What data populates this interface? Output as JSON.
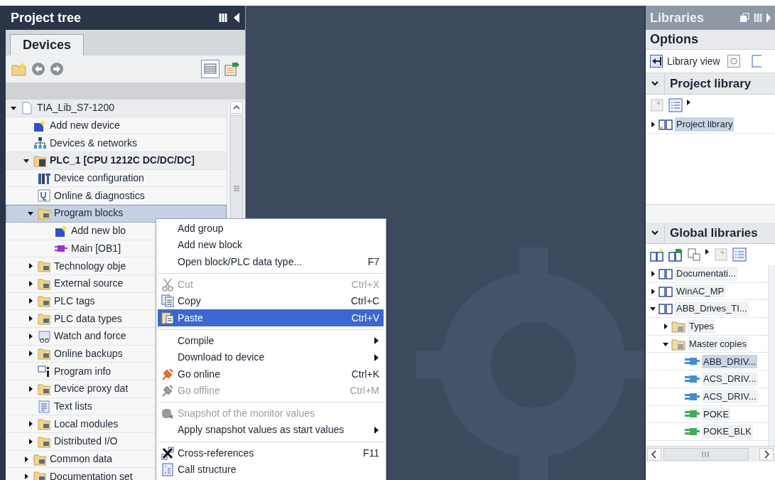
{
  "project_tree": {
    "title": "Project tree",
    "tabs": [
      {
        "label": "Devices",
        "selected": true
      }
    ],
    "items": [
      {
        "label": "TIA_Lib_S7-1200",
        "kind": "project",
        "expanded": true,
        "children": [
          {
            "label": "Add new device",
            "kind": "add"
          },
          {
            "label": "Devices & networks",
            "kind": "network"
          },
          {
            "label": "PLC_1 [CPU 1212C DC/DC/DC]",
            "kind": "plc",
            "expanded": true,
            "children": [
              {
                "label": "Device configuration",
                "kind": "config"
              },
              {
                "label": "Online & diagnostics",
                "kind": "diagnostics"
              },
              {
                "label": "Program blocks",
                "kind": "folder",
                "expanded": true,
                "selected": true,
                "children": [
                  {
                    "label": "Add new blo",
                    "kind": "add"
                  },
                  {
                    "label": "Main [OB1]",
                    "kind": "block"
                  }
                ]
              },
              {
                "label": "Technology obje",
                "kind": "folder",
                "expanded": false
              },
              {
                "label": "External source",
                "kind": "folder",
                "expanded": false
              },
              {
                "label": "PLC tags",
                "kind": "folder",
                "expanded": false
              },
              {
                "label": "PLC data types",
                "kind": "folder",
                "expanded": false
              },
              {
                "label": "Watch and force",
                "kind": "watch",
                "expanded": false
              },
              {
                "label": "Online backups",
                "kind": "folder",
                "expanded": false
              },
              {
                "label": "Program info",
                "kind": "info"
              },
              {
                "label": "Device proxy dat",
                "kind": "folder",
                "expanded": false
              },
              {
                "label": "Text lists",
                "kind": "textlist"
              },
              {
                "label": "Local modules",
                "kind": "folder",
                "expanded": false
              },
              {
                "label": "Distributed I/O",
                "kind": "folder",
                "expanded": false
              }
            ]
          },
          {
            "label": "Common data",
            "kind": "folder",
            "expanded": false
          },
          {
            "label": "Documentation set",
            "kind": "folder",
            "expanded": false
          }
        ]
      }
    ]
  },
  "context_menu": [
    {
      "kind": "item",
      "label": "Add group",
      "disabled": false,
      "selected": false
    },
    {
      "kind": "item",
      "label": "Add new block",
      "disabled": false,
      "selected": false
    },
    {
      "kind": "item",
      "label": "Open block/PLC data type...",
      "shortcut": "F7",
      "disabled": false,
      "selected": false
    },
    {
      "kind": "separator"
    },
    {
      "kind": "item",
      "label": "Cut",
      "shortcut": "Ctrl+X",
      "disabled": true,
      "selected": false
    },
    {
      "kind": "item",
      "label": "Copy",
      "shortcut": "Ctrl+C",
      "disabled": false,
      "selected": false
    },
    {
      "kind": "item",
      "label": "Paste",
      "shortcut": "Ctrl+V",
      "disabled": false,
      "selected": true
    },
    {
      "kind": "separator"
    },
    {
      "kind": "item",
      "label": "Compile",
      "submenu": true,
      "disabled": false,
      "selected": false
    },
    {
      "kind": "item",
      "label": "Download to device",
      "submenu": true,
      "disabled": false,
      "selected": false
    },
    {
      "kind": "item",
      "label": "Go online",
      "shortcut": "Ctrl+K",
      "disabled": false,
      "selected": false
    },
    {
      "kind": "item",
      "label": "Go offline",
      "shortcut": "Ctrl+M",
      "disabled": true,
      "selected": false
    },
    {
      "kind": "separator"
    },
    {
      "kind": "item",
      "label": "Snapshot of the monitor values",
      "disabled": true,
      "selected": false
    },
    {
      "kind": "item",
      "label": "Apply snapshot values as start values",
      "submenu": true,
      "disabled": false,
      "selected": false
    },
    {
      "kind": "separator"
    },
    {
      "kind": "item",
      "label": "Cross-references",
      "shortcut": "F11",
      "disabled": false,
      "selected": false
    },
    {
      "kind": "item",
      "label": "Call structure",
      "disabled": false,
      "selected": false
    }
  ],
  "libraries": {
    "title": "Libraries",
    "options": "Options",
    "library_view": "Library view",
    "project_library": {
      "title": "Project library",
      "expanded": true,
      "items": [
        {
          "label": "Project library",
          "kind": "library",
          "expanded": false,
          "selected": true
        }
      ]
    },
    "global_libraries": {
      "title": "Global libraries",
      "expanded": true,
      "items": [
        {
          "label": "Documentati...",
          "kind": "library",
          "expanded": false,
          "selected": false
        },
        {
          "label": "WinAC_MP",
          "kind": "library",
          "expanded": false,
          "selected": false
        },
        {
          "label": "ABB_Drives_TI...",
          "kind": "library",
          "expanded": true,
          "selected": false,
          "children": [
            {
              "label": "Types",
              "kind": "folder",
              "expanded": false,
              "selected": false
            },
            {
              "label": "Master copies",
              "kind": "folder",
              "expanded": true,
              "selected": false,
              "children": [
                {
                  "label": "ABB_DRIV...",
                  "kind": "block",
                  "color": "#3f8fd8",
                  "selected": true
                },
                {
                  "label": "ACS_DRIV...",
                  "kind": "block",
                  "color": "#3f8fd8",
                  "selected": false
                },
                {
                  "label": "ACS_DRIV...",
                  "kind": "block",
                  "color": "#3f8fd8",
                  "selected": false
                },
                {
                  "label": "POKE",
                  "kind": "block",
                  "color": "#3fae5a",
                  "selected": false
                },
                {
                  "label": "POKE_BLK",
                  "kind": "block",
                  "color": "#3fae5a",
                  "selected": false
                }
              ]
            }
          ]
        }
      ]
    }
  }
}
